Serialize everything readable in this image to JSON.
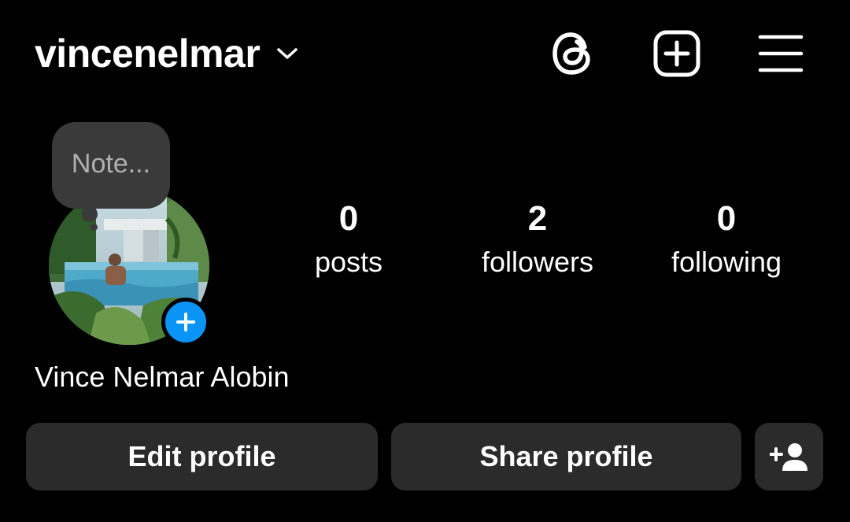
{
  "header": {
    "username": "vincenelmar",
    "icons": [
      "chevron-down-icon",
      "threads-icon",
      "create-plus-icon",
      "hamburger-menu-icon"
    ]
  },
  "note": {
    "placeholder": "Note..."
  },
  "profile": {
    "full_name": "Vince Nelmar Alobin",
    "add_story_icon": "plus-icon",
    "accent_color": "#0a95f6"
  },
  "stats": {
    "posts": {
      "count": "0",
      "label": "posts"
    },
    "followers": {
      "count": "2",
      "label": "followers"
    },
    "following": {
      "count": "0",
      "label": "following"
    }
  },
  "actions": {
    "edit_label": "Edit profile",
    "share_label": "Share profile",
    "discover_icon": "add-person-icon"
  }
}
